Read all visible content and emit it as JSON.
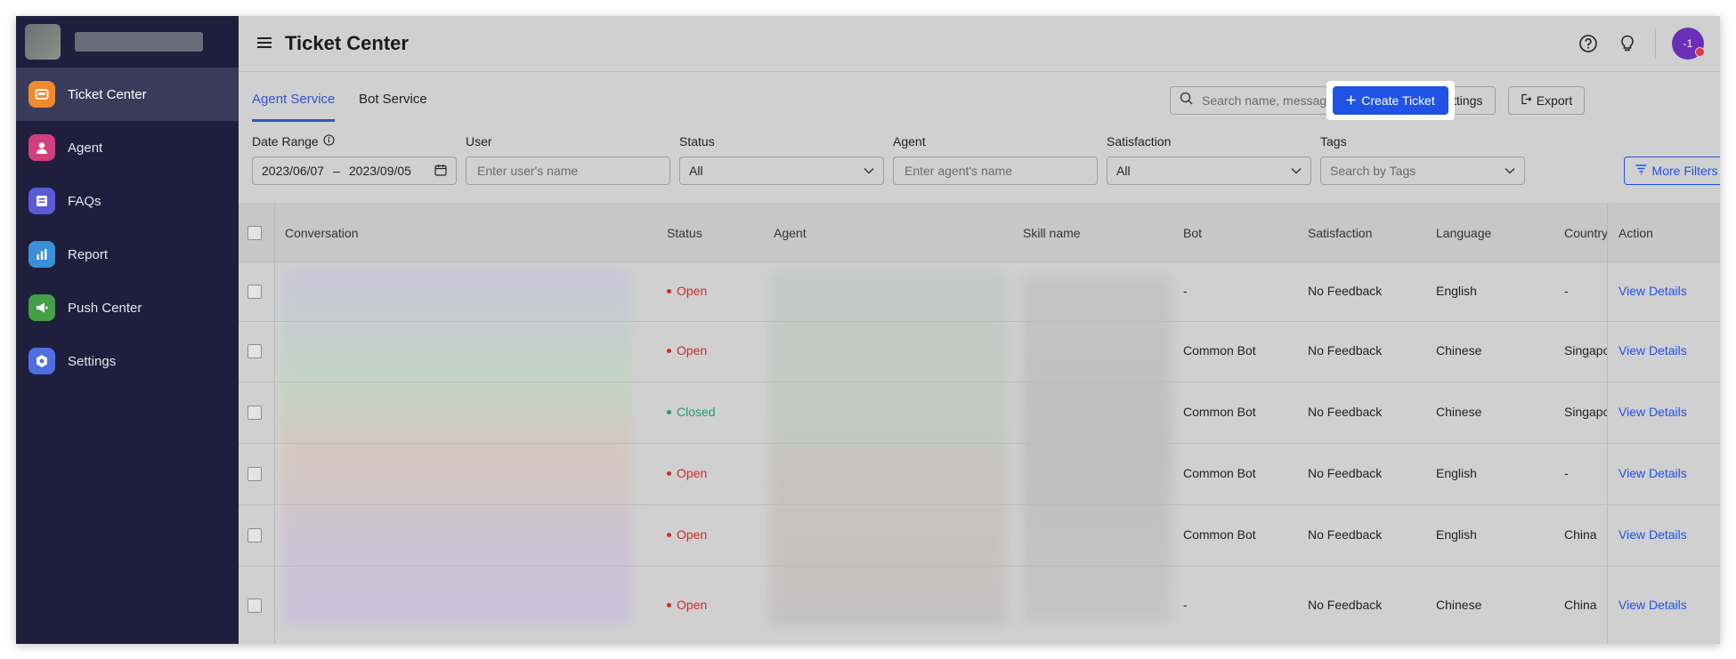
{
  "app": {
    "title": "Ticket Center"
  },
  "sidebar": {
    "items": [
      {
        "label": "Ticket Center",
        "icon": "ticket-icon",
        "color": "#f08a2c",
        "active": true
      },
      {
        "label": "Agent",
        "icon": "agent-icon",
        "color": "#d23f7e"
      },
      {
        "label": "FAQs",
        "icon": "faq-icon",
        "color": "#5a5bd6"
      },
      {
        "label": "Report",
        "icon": "report-icon",
        "color": "#3b8fd6"
      },
      {
        "label": "Push Center",
        "icon": "megaphone-icon",
        "color": "#43a047"
      },
      {
        "label": "Settings",
        "icon": "settings-icon",
        "color": "#4f6fe0"
      }
    ]
  },
  "header": {
    "avatar_text": "-1"
  },
  "tabs": [
    {
      "label": "Agent Service",
      "active": true
    },
    {
      "label": "Bot Service",
      "active": false
    }
  ],
  "toolbar": {
    "search_placeholder": "Search name, messag...",
    "field_settings": "Field Settings",
    "export": "Export",
    "create_ticket": "Create Ticket"
  },
  "filters": {
    "date_range": {
      "label": "Date Range",
      "start": "2023/06/07",
      "separator": "–",
      "end": "2023/09/05"
    },
    "user": {
      "label": "User",
      "placeholder": "Enter user's name"
    },
    "status": {
      "label": "Status",
      "value": "All"
    },
    "agent": {
      "label": "Agent",
      "placeholder": "Enter agent's name"
    },
    "satisfaction": {
      "label": "Satisfaction",
      "value": "All"
    },
    "tags": {
      "label": "Tags",
      "placeholder": "Search by Tags"
    },
    "more_filters": "More Filters"
  },
  "table": {
    "columns": [
      "Conversation",
      "Status",
      "Agent",
      "Skill name",
      "Bot",
      "Satisfaction",
      "Language",
      "Country",
      "Action"
    ],
    "rows": [
      {
        "status": "Open",
        "bot": "-",
        "satisfaction": "No Feedback",
        "language": "English",
        "country": "-",
        "action": "View Details"
      },
      {
        "status": "Open",
        "bot": "Common Bot",
        "satisfaction": "No Feedback",
        "language": "Chinese",
        "country": "Singapore",
        "action": "View Details"
      },
      {
        "status": "Closed",
        "bot": "Common Bot",
        "satisfaction": "No Feedback",
        "language": "Chinese",
        "country": "Singapore",
        "action": "View Details"
      },
      {
        "status": "Open",
        "bot": "Common Bot",
        "satisfaction": "No Feedback",
        "language": "English",
        "country": "-",
        "action": "View Details"
      },
      {
        "status": "Open",
        "bot": "Common Bot",
        "satisfaction": "No Feedback",
        "language": "English",
        "country": "China",
        "action": "View Details"
      },
      {
        "status": "Open",
        "bot": "-",
        "satisfaction": "No Feedback",
        "language": "Chinese",
        "country": "China",
        "action": "View Details"
      }
    ]
  },
  "colors": {
    "accent": "#2152e6",
    "open": "#d12b2b",
    "closed": "#1f9e6a",
    "sidebar_bg": "#1f1f3d"
  }
}
